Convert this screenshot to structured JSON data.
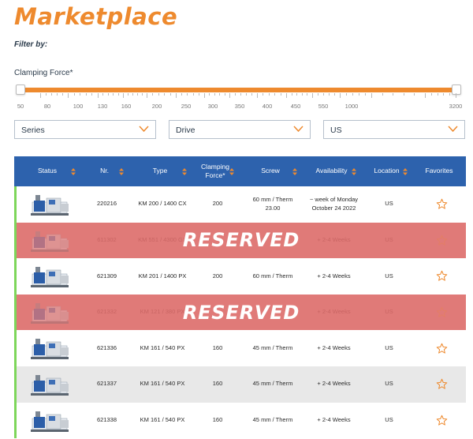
{
  "page": {
    "title": "Marketplace",
    "filter_label": "Filter by:"
  },
  "slider": {
    "label": "Clamping Force*",
    "ticks": [
      "50",
      "80",
      "100",
      "130",
      "160",
      "200",
      "250",
      "300",
      "350",
      "400",
      "450",
      "550",
      "1000",
      "3200"
    ],
    "accent_color": "#ee8a2e"
  },
  "filters": [
    {
      "value": "Series",
      "icon": "chevron-down-icon"
    },
    {
      "value": "Drive",
      "icon": "chevron-down-icon"
    },
    {
      "value": "US",
      "icon": "chevron-down-icon"
    }
  ],
  "table": {
    "header_color": "#2d62ad",
    "columns": [
      "Status",
      "Nr.",
      "Type",
      "Clamping Force*",
      "Screw",
      "Availability",
      "Location",
      "Favorites"
    ],
    "reserved_label": "RESERVED",
    "rows": [
      {
        "nr": "220216",
        "type": "KM 200 / 1400 CX",
        "force": "200",
        "screw": "60 mm / Therm 23.00",
        "availability": "~ week of Monday October 24 2022",
        "location": "US",
        "reserved": false,
        "alt": false
      },
      {
        "nr": "611302",
        "type": "KM 551 / 4300 GX",
        "force": "",
        "screw": "",
        "availability": "+ 2-4 Weeks",
        "location": "US",
        "reserved": true,
        "alt": false
      },
      {
        "nr": "621309",
        "type": "KM 201 / 1400 PX",
        "force": "200",
        "screw": "60 mm / Therm",
        "availability": "+ 2-4 Weeks",
        "location": "US",
        "reserved": false,
        "alt": false
      },
      {
        "nr": "621332",
        "type": "KM 121 / 380 PX",
        "force": "",
        "screw": "",
        "availability": "+ 2-4 Weeks",
        "location": "US",
        "reserved": true,
        "alt": false
      },
      {
        "nr": "621336",
        "type": "KM 161 / 540 PX",
        "force": "160",
        "screw": "45 mm / Therm",
        "availability": "+ 2-4 Weeks",
        "location": "US",
        "reserved": false,
        "alt": false
      },
      {
        "nr": "621337",
        "type": "KM 161 / 540 PX",
        "force": "160",
        "screw": "45 mm / Therm",
        "availability": "+ 2-4 Weeks",
        "location": "US",
        "reserved": false,
        "alt": true
      },
      {
        "nr": "621338",
        "type": "KM 161 / 540 PX",
        "force": "160",
        "screw": "45 mm / Therm",
        "availability": "+ 2-4 Weeks",
        "location": "US",
        "reserved": false,
        "alt": false
      }
    ]
  }
}
